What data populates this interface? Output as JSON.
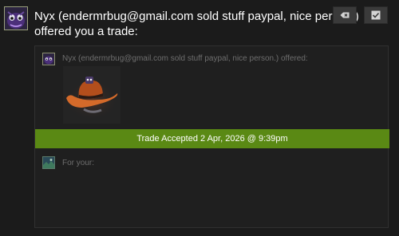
{
  "header": {
    "sender_line": "Nyx (endermrbug@gmail.com sold stuff paypal, nice person.)",
    "action_line": "offered you a trade:",
    "avatar_icon": "purple-creature-avatar-icon"
  },
  "actions": {
    "dismiss_icon": "dismiss-icon",
    "accept_icon": "checkmark-icon"
  },
  "trade": {
    "offer_label": "Nyx (endermrbug@gmail.com sold stuff paypal, nice person.) offered:",
    "offered_item_icon": "cowboy-hat-item-icon",
    "status_text": "Trade Accepted 2 Apr, 2026 @ 9:39pm",
    "status_color": "#5a8914",
    "for_your_label": "For your:",
    "for_your_avatar_icon": "landscape-avatar-icon"
  }
}
